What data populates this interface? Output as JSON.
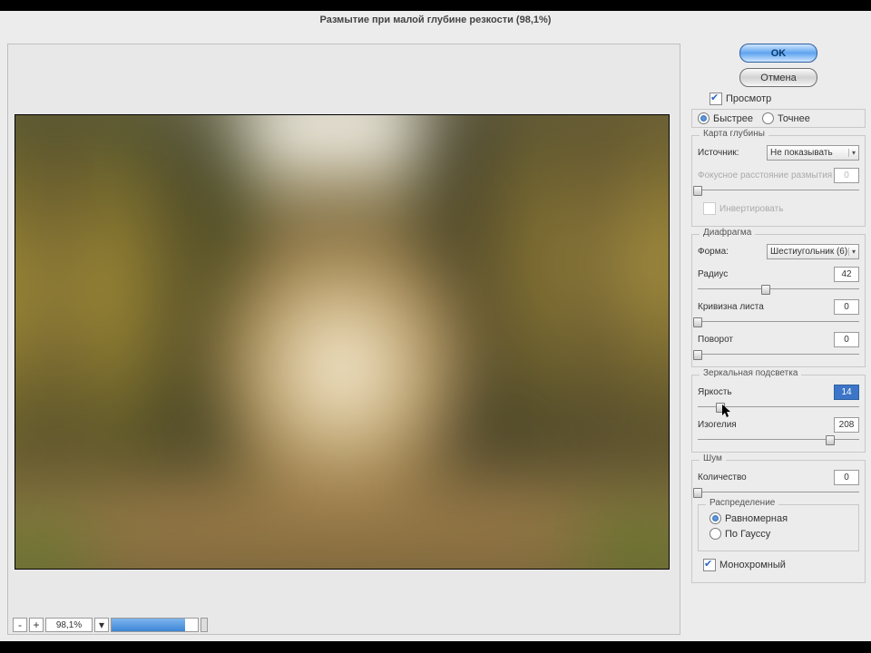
{
  "title": "Размытие при малой глубине резкости (98,1%)",
  "buttons": {
    "ok": "OK",
    "cancel": "Отмена"
  },
  "preview_checkbox": "Просмотр",
  "mode": {
    "fast": "Быстрее",
    "accurate": "Точнее"
  },
  "depth_map": {
    "legend": "Карта глубины",
    "source_label": "Источник:",
    "source_value": "Не показывать",
    "focal_label": "Фокусное расстояние размытия",
    "focal_value": "0",
    "invert": "Инвертировать"
  },
  "iris": {
    "legend": "Диафрагма",
    "shape_label": "Форма:",
    "shape_value": "Шестиугольник (6)",
    "radius_label": "Радиус",
    "radius_value": "42",
    "curvature_label": "Кривизна листа",
    "curvature_value": "0",
    "rotation_label": "Поворот",
    "rotation_value": "0"
  },
  "highlights": {
    "legend": "Зеркальная подсветка",
    "brightness_label": "Яркость",
    "brightness_value": "14",
    "threshold_label": "Изогелия",
    "threshold_value": "208"
  },
  "noise": {
    "legend": "Шум",
    "amount_label": "Количество",
    "amount_value": "0",
    "dist_legend": "Распределение",
    "uniform": "Равномерная",
    "gaussian": "По Гауссу",
    "mono": "Монохромный"
  },
  "zoom": {
    "minus": "-",
    "plus": "+",
    "value": "98,1%"
  }
}
